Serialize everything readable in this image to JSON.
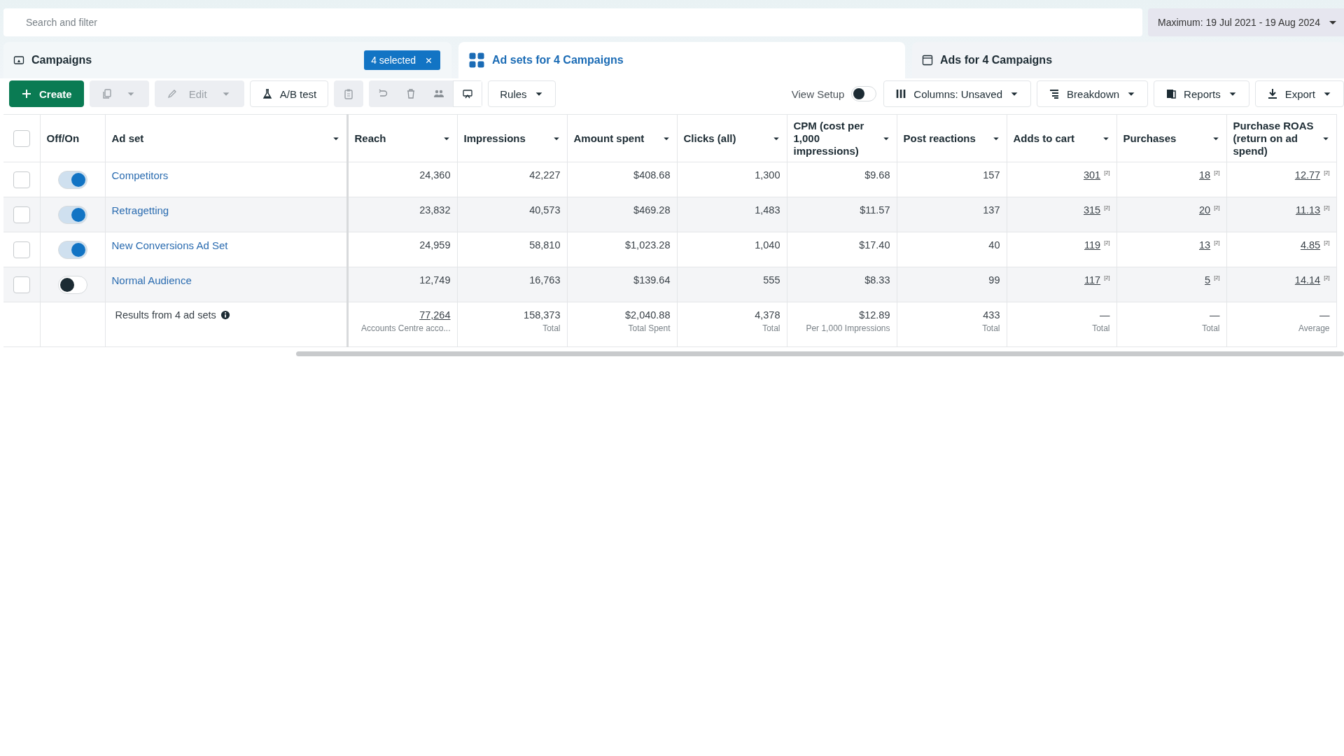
{
  "search": {
    "placeholder": "Search and filter"
  },
  "date_range": "Maximum: 19 Jul 2021 - 19 Aug 2024",
  "tabs": [
    {
      "label": "Campaigns",
      "selected": false,
      "badge": "4 selected"
    },
    {
      "label": "Ad sets for 4 Campaigns",
      "selected": true
    },
    {
      "label": "Ads for 4 Campaigns",
      "selected": false
    }
  ],
  "toolbar_left": [
    {
      "kind": "primary",
      "label": "Create"
    },
    {
      "kind": "split",
      "disabled": true
    },
    {
      "kind": "split",
      "label": "Edit",
      "disabled": true
    },
    {
      "kind": "button",
      "label": "A/B test"
    },
    {
      "kind": "icon",
      "disabled": true
    },
    {
      "kind": "group"
    },
    {
      "kind": "dropdown",
      "label": "Rules"
    }
  ],
  "toolbar_right": [
    {
      "kind": "toggle",
      "label": "View Setup",
      "on": false
    },
    {
      "kind": "dropdown",
      "label": "Columns: Unsaved"
    },
    {
      "kind": "dropdown",
      "label": "Breakdown"
    },
    {
      "kind": "dropdown",
      "label": "Reports"
    },
    {
      "kind": "dropdown",
      "label": "Export"
    }
  ],
  "table": {
    "select_all": {
      "checked": false
    },
    "toggle_column": {
      "label": "Off/On"
    },
    "name_column": {
      "label": "Ad set"
    },
    "columns": [
      {
        "label": "Reach"
      },
      {
        "label": "Impressions"
      },
      {
        "label": "Amount spent"
      },
      {
        "label": "Clicks (all)"
      },
      {
        "label": "CPM (cost per 1,000 impressions)"
      },
      {
        "label": "Post reactions"
      },
      {
        "label": "Adds to cart"
      },
      {
        "label": "Purchases"
      },
      {
        "label": "Purchase ROAS (return on ad spend)"
      }
    ],
    "rows": [
      {
        "checked": false,
        "on": true,
        "name": "Competitors",
        "cells": [
          {
            "value": "24,360"
          },
          {
            "value": "42,227"
          },
          {
            "value": "$408.68"
          },
          {
            "value": "1,300"
          },
          {
            "value": "$9.68"
          },
          {
            "value": "157"
          },
          {
            "value": "301",
            "underlined": true,
            "note": "[2]"
          },
          {
            "value": "18",
            "underlined": true,
            "note": "[2]"
          },
          {
            "value": "12.77",
            "underlined": true,
            "note": "[2]"
          }
        ]
      },
      {
        "checked": false,
        "on": true,
        "name": "Retragetting",
        "cells": [
          {
            "value": "23,832"
          },
          {
            "value": "40,573"
          },
          {
            "value": "$469.28"
          },
          {
            "value": "1,483"
          },
          {
            "value": "$11.57"
          },
          {
            "value": "137"
          },
          {
            "value": "315",
            "underlined": true,
            "note": "[2]"
          },
          {
            "value": "20",
            "underlined": true,
            "note": "[2]"
          },
          {
            "value": "11.13",
            "underlined": true,
            "note": "[2]"
          }
        ]
      },
      {
        "checked": false,
        "on": true,
        "name": "New Conversions Ad Set",
        "cells": [
          {
            "value": "24,959"
          },
          {
            "value": "58,810"
          },
          {
            "value": "$1,023.28"
          },
          {
            "value": "1,040"
          },
          {
            "value": "$17.40"
          },
          {
            "value": "40"
          },
          {
            "value": "119",
            "underlined": true,
            "note": "[2]"
          },
          {
            "value": "13",
            "underlined": true,
            "note": "[2]"
          },
          {
            "value": "4.85",
            "underlined": true,
            "note": "[2]"
          }
        ]
      },
      {
        "checked": false,
        "on": false,
        "name": "Normal Audience",
        "cells": [
          {
            "value": "12,749"
          },
          {
            "value": "16,763"
          },
          {
            "value": "$139.64"
          },
          {
            "value": "555"
          },
          {
            "value": "$8.33"
          },
          {
            "value": "99"
          },
          {
            "value": "117",
            "underlined": true,
            "note": "[2]"
          },
          {
            "value": "5",
            "underlined": true,
            "note": "[2]"
          },
          {
            "value": "14.14",
            "underlined": true,
            "note": "[2]"
          }
        ]
      }
    ],
    "totals": {
      "label": "Results from 4 ad sets",
      "cells": [
        {
          "value": "77,264",
          "underlined": true,
          "sub": "Accounts Centre acco..."
        },
        {
          "value": "158,373",
          "sub": "Total"
        },
        {
          "value": "$2,040.88",
          "sub": "Total Spent"
        },
        {
          "value": "4,378",
          "sub": "Total"
        },
        {
          "value": "$12.89",
          "sub": "Per 1,000 Impressions"
        },
        {
          "value": "433",
          "sub": "Total"
        },
        {
          "value": "—",
          "sub": "Total"
        },
        {
          "value": "—",
          "sub": "Total"
        },
        {
          "value": "—",
          "sub": "Average"
        }
      ]
    }
  }
}
